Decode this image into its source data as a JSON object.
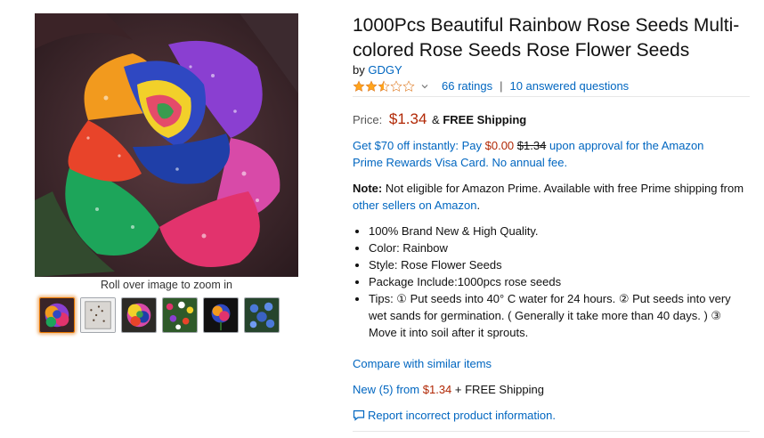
{
  "gallery": {
    "zoom_hint": "Roll over image to zoom in",
    "thumbnails": [
      {
        "name": "thumb-rainbow-rose-1",
        "selected": true
      },
      {
        "name": "thumb-seed-packet",
        "selected": false
      },
      {
        "name": "thumb-rainbow-rose-2",
        "selected": false
      },
      {
        "name": "thumb-flower-garden",
        "selected": false
      },
      {
        "name": "thumb-rainbow-rose-dark",
        "selected": false
      },
      {
        "name": "thumb-blue-flowers",
        "selected": false
      }
    ]
  },
  "product": {
    "title": "1000Pcs Beautiful Rainbow Rose Seeds Multi-colored Rose Seeds Rose Flower Seeds",
    "by_label": "by",
    "brand": "GDGY",
    "rating": {
      "stars": 2.5,
      "out_of": 5,
      "ratings_link": "66 ratings",
      "separator": "|",
      "questions_link": "10 answered questions"
    },
    "price": {
      "label": "Price:",
      "value": "$1.34",
      "amp": "&",
      "shipping": "FREE Shipping"
    },
    "promo": {
      "pre": "Get $70 off instantly: Pay ",
      "pay_price": "$0.00",
      "old_price": "$1.34",
      "post": " upon approval for the Amazon Prime Rewards Visa Card. No annual fee."
    },
    "note": {
      "label": "Note:",
      "text": " Not eligible for Amazon Prime. Available with free Prime shipping from ",
      "link": "other sellers on Amazon",
      "end": "."
    },
    "bullets": [
      "100% Brand New & High Quality.",
      "Color: Rainbow",
      "Style: Rose Flower Seeds",
      "Package Include:1000pcs rose seeds",
      "Tips:  ① Put seeds into 40° C water for 24 hours. ② Put seeds into very wet sands for germination. ( Generally it take more than 40 days. ) ③ Move it into soil after it sprouts."
    ],
    "compare_link": "Compare with similar items",
    "new_offers": {
      "link": "New (5) from",
      "price": "$1.34",
      "suffix": " + FREE Shipping"
    },
    "report_link": "Report incorrect product information."
  },
  "colors": {
    "link": "#0066c0",
    "price": "#b12704",
    "star": "#ffa41c",
    "selected_thumb": "#e77600"
  }
}
